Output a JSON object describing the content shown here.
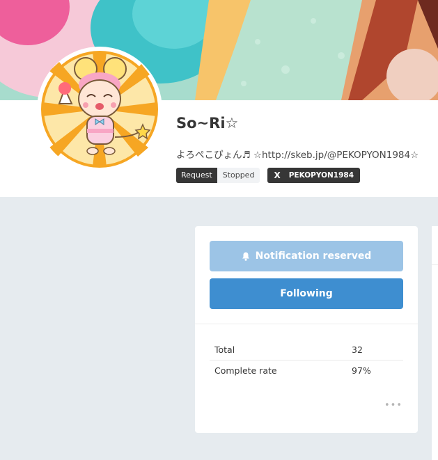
{
  "profile": {
    "name": "So~Ri☆",
    "bio": "よろぺこぴょん♬ ☆http://skeb.jp/@PEKOPYON1984☆",
    "request_label": "Request",
    "request_status": "Stopped",
    "x_handle": "PEKOPYON1984",
    "x_icon": "X"
  },
  "card": {
    "notification_label": "Notification reserved",
    "following_label": "Following",
    "stats": [
      {
        "label": "Total",
        "value": "32"
      },
      {
        "label": "Complete rate",
        "value": "97%"
      }
    ],
    "more_label": "•••"
  },
  "colors": {
    "accent": "#3e8ed0",
    "accent_light": "#9cc4e6",
    "page_bg": "#e6ebef",
    "dark": "#363636"
  },
  "icons": [
    "bell-icon",
    "x-logo-icon",
    "more-icon"
  ]
}
